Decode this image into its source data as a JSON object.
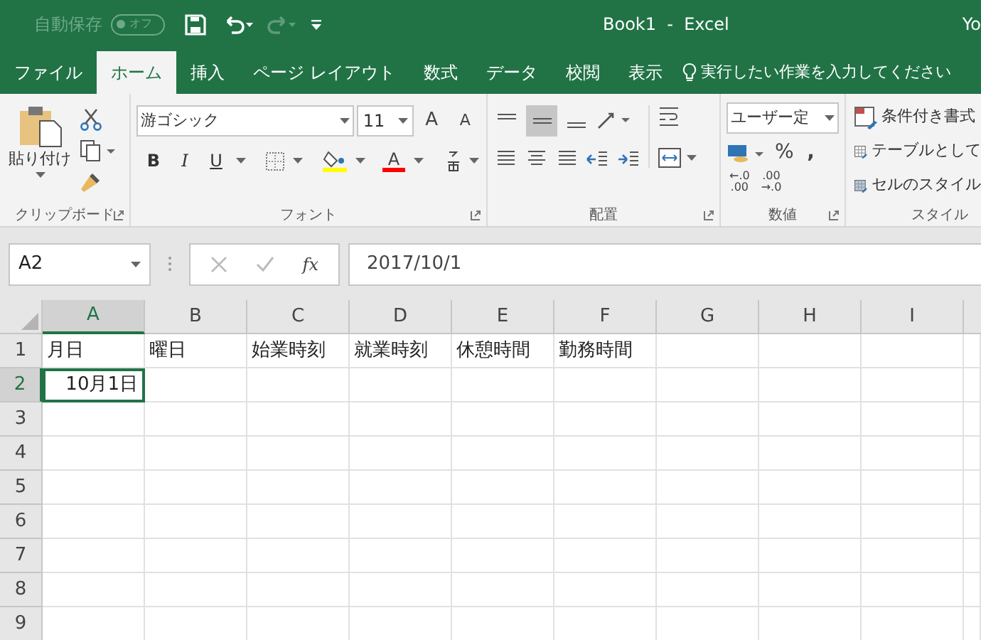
{
  "title_bar": {
    "autosave_label": "自動保存",
    "autosave_toggle": {
      "label": "オフ",
      "on": false
    },
    "title": "Book1  -  Excel",
    "user": "Yo"
  },
  "tabs": [
    {
      "label": "ファイル",
      "selected": false
    },
    {
      "label": "ホーム",
      "selected": true
    },
    {
      "label": "挿入",
      "selected": false
    },
    {
      "label": "ページ レイアウト",
      "selected": false
    },
    {
      "label": "数式",
      "selected": false
    },
    {
      "label": "データ",
      "selected": false
    },
    {
      "label": "校閲",
      "selected": false
    },
    {
      "label": "表示",
      "selected": false
    }
  ],
  "tell_me": "実行したい作業を入力してください",
  "ribbon": {
    "clipboard": {
      "paste": "貼り付け",
      "label": "クリップボード"
    },
    "font": {
      "name": "游ゴシック",
      "size": "11",
      "grow": "A",
      "shrink": "A",
      "bold": "B",
      "italic": "I",
      "underline": "U",
      "font_color": "A",
      "label": "フォント"
    },
    "alignment": {
      "label": "配置"
    },
    "number": {
      "format": "ユーザー定",
      "percent": "%",
      "comma": ",",
      "increase_decimal": [
        "←.0",
        ".00"
      ],
      "decrease_decimal": [
        ".00",
        "→.0"
      ],
      "label": "数値"
    },
    "styles": {
      "items": [
        "条件付き書式",
        "テーブルとして",
        "セルのスタイル"
      ],
      "label": "スタイル"
    }
  },
  "formula_bar": {
    "name_box": "A2",
    "function_label": "fx",
    "value": "2017/10/1"
  },
  "sheet": {
    "columns": [
      {
        "label": "A",
        "selected": true
      },
      {
        "label": "B",
        "selected": false
      },
      {
        "label": "C",
        "selected": false
      },
      {
        "label": "D",
        "selected": false
      },
      {
        "label": "E",
        "selected": false
      },
      {
        "label": "F",
        "selected": false
      },
      {
        "label": "G",
        "selected": false
      },
      {
        "label": "H",
        "selected": false
      },
      {
        "label": "I",
        "selected": false
      }
    ],
    "rows": [
      {
        "label": "1",
        "selected": false,
        "cells": [
          {
            "text": "月日",
            "selected": false
          },
          {
            "text": "曜日",
            "selected": false
          },
          {
            "text": "始業時刻",
            "selected": false
          },
          {
            "text": "就業時刻",
            "selected": false
          },
          {
            "text": "休憩時間",
            "selected": false
          },
          {
            "text": "勤務時間",
            "selected": false
          }
        ]
      },
      {
        "label": "2",
        "selected": true,
        "cells": [
          {
            "text": "10月1日",
            "selected": true
          }
        ]
      },
      {
        "label": "3",
        "selected": false
      },
      {
        "label": "4",
        "selected": false
      },
      {
        "label": "5",
        "selected": false
      },
      {
        "label": "6",
        "selected": false
      },
      {
        "label": "7",
        "selected": false
      },
      {
        "label": "8",
        "selected": false
      },
      {
        "label": "9",
        "selected": false
      }
    ]
  }
}
